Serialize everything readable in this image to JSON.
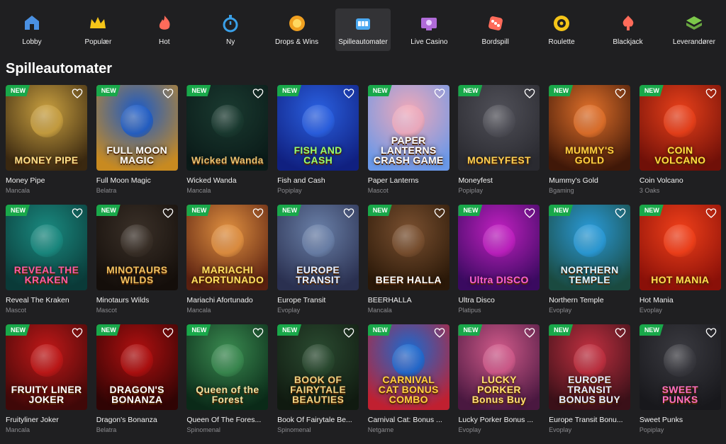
{
  "nav": {
    "items": [
      {
        "label": "Lobby",
        "icon": "lobby-icon",
        "color": "#4a90e2",
        "active": false
      },
      {
        "label": "Populær",
        "icon": "crown-icon",
        "color": "#f5c518",
        "active": false
      },
      {
        "label": "Hot",
        "icon": "flame-icon",
        "color": "#ff6b5a",
        "active": false
      },
      {
        "label": "Ny",
        "icon": "stopwatch-icon",
        "color": "#3aa0e8",
        "active": false
      },
      {
        "label": "Drops & Wins",
        "icon": "drops-wins-icon",
        "color": "#f0a020",
        "active": false
      },
      {
        "label": "Spilleautomater",
        "icon": "slot-machine-icon",
        "color": "#4aa8f0",
        "active": true
      },
      {
        "label": "Live Casino",
        "icon": "live-casino-icon",
        "color": "#b06bd8",
        "active": false
      },
      {
        "label": "Bordspill",
        "icon": "dice-icon",
        "color": "#ff6b5a",
        "active": false
      },
      {
        "label": "Roulette",
        "icon": "roulette-icon",
        "color": "#f5c518",
        "active": false
      },
      {
        "label": "Blackjack",
        "icon": "blackjack-icon",
        "color": "#ff6b5a",
        "active": false
      },
      {
        "label": "Leverandører",
        "icon": "providers-icon",
        "color": "#7cc84a",
        "active": false
      }
    ]
  },
  "page": {
    "title": "Spilleautomater"
  },
  "badge_label": "NEW",
  "games": [
    {
      "name": "Money Pipe",
      "provider": "Mancala",
      "art": "MONEY PIPE",
      "bg": [
        "#c9a040",
        "#3a2810"
      ],
      "fg": "#ffe08a"
    },
    {
      "name": "Full Moon Magic",
      "provider": "Belatra",
      "art": "FULL MOON MAGIC",
      "bg": [
        "#1a5ac8",
        "#c88a20"
      ],
      "fg": "#ffffff"
    },
    {
      "name": "Wicked Wanda",
      "provider": "Mancala",
      "art": "Wicked Wanda",
      "bg": [
        "#1a3a30",
        "#0a1a18"
      ],
      "fg": "#e8c070"
    },
    {
      "name": "Fish and Cash",
      "provider": "Popiplay",
      "art": "FISH AND CASH",
      "bg": [
        "#2a60e0",
        "#102080"
      ],
      "fg": "#9cff6a"
    },
    {
      "name": "Paper Lanterns",
      "provider": "Mascot",
      "art": "PAPER LANTERNS CRASH GAME",
      "bg": [
        "#f0a8b8",
        "#6a98e8"
      ],
      "fg": "#ffffff"
    },
    {
      "name": "Moneyfest",
      "provider": "Popiplay",
      "art": "MONEYFEST",
      "bg": [
        "#505058",
        "#2a2a30"
      ],
      "fg": "#ffd050"
    },
    {
      "name": "Mummy's Gold",
      "provider": "Bgaming",
      "art": "MUMMY'S GOLD",
      "bg": [
        "#e0702a",
        "#401808"
      ],
      "fg": "#ffd040"
    },
    {
      "name": "Coin Volcano",
      "provider": "3 Oaks",
      "art": "COIN VOLCANO",
      "bg": [
        "#e8401a",
        "#701008"
      ],
      "fg": "#ffe040"
    },
    {
      "name": "Reveal The Kraken",
      "provider": "Mascot",
      "art": "REVEAL THE KRAKEN",
      "bg": [
        "#1a8a80",
        "#0a3a38"
      ],
      "fg": "#ff5aa0"
    },
    {
      "name": "Minotaurs Wilds",
      "provider": "Mascot",
      "art": "MINOTAURS WILDS",
      "bg": [
        "#3a3028",
        "#140e0a"
      ],
      "fg": "#f0c060"
    },
    {
      "name": "Mariachi Afortunado",
      "provider": "Mancala",
      "art": "MARIACHI AFORTUNADO",
      "bg": [
        "#e09040",
        "#5a2010"
      ],
      "fg": "#ffe060"
    },
    {
      "name": "Europe Transit",
      "provider": "Evoplay",
      "art": "EUROPE TRANSIT",
      "bg": [
        "#6a80a8",
        "#2a3050"
      ],
      "fg": "#e8f0ff"
    },
    {
      "name": "BEERHALLA",
      "provider": "Mancala",
      "art": "BEER HALLA",
      "bg": [
        "#7a5030",
        "#2a1808"
      ],
      "fg": "#ffffff"
    },
    {
      "name": "Ultra Disco",
      "provider": "Platipus",
      "art": "Ultra DISCO",
      "bg": [
        "#c020c0",
        "#3a0a60"
      ],
      "fg": "#ff60d0"
    },
    {
      "name": "Northern Temple",
      "provider": "Evoplay",
      "art": "NORTHERN TEMPLE",
      "bg": [
        "#2a9ad8",
        "#1a4a40"
      ],
      "fg": "#e0f4ff"
    },
    {
      "name": "Hot Mania",
      "provider": "Evoplay",
      "art": "HOT MANIA",
      "bg": [
        "#f0401a",
        "#8a1008"
      ],
      "fg": "#ffe050"
    },
    {
      "name": "Fruityliner Joker",
      "provider": "Mancala",
      "art": "FRUITY LINER JOKER",
      "bg": [
        "#c01818",
        "#400808"
      ],
      "fg": "#ffffff"
    },
    {
      "name": "Dragon's Bonanza",
      "provider": "Belatra",
      "art": "DRAGON'S BONANZA",
      "bg": [
        "#b01010",
        "#300404"
      ],
      "fg": "#ffffff"
    },
    {
      "name": "Queen Of The Fores...",
      "provider": "Spinomenal",
      "art": "Queen of the Forest",
      "bg": [
        "#3a8a50",
        "#0a2a18"
      ],
      "fg": "#f0e0a0"
    },
    {
      "name": "Book Of Fairytale Be...",
      "provider": "Spinomenal",
      "art": "BOOK OF FAIRYTALE BEAUTIES",
      "bg": [
        "#2a4a30",
        "#101a10"
      ],
      "fg": "#f0d080"
    },
    {
      "name": "Carnival Cat: Bonus ...",
      "provider": "Netgame",
      "art": "CARNIVAL CAT BONUS COMBO",
      "bg": [
        "#1a6ad0",
        "#c02030"
      ],
      "fg": "#ffd040"
    },
    {
      "name": "Lucky Porker Bonus ...",
      "provider": "Evoplay",
      "art": "LUCKY PORKER Bonus Buy",
      "bg": [
        "#d05a8a",
        "#4a1840"
      ],
      "fg": "#ffe070"
    },
    {
      "name": "Europe Transit Bonu...",
      "provider": "Evoplay",
      "art": "EUROPE TRANSIT BONUS BUY",
      "bg": [
        "#c03040",
        "#3a1018"
      ],
      "fg": "#e8f0ff"
    },
    {
      "name": "Sweet Punks",
      "provider": "Popiplay",
      "art": "SWEET PUNKS",
      "bg": [
        "#3a3a40",
        "#18181c"
      ],
      "fg": "#ff70c0"
    }
  ]
}
